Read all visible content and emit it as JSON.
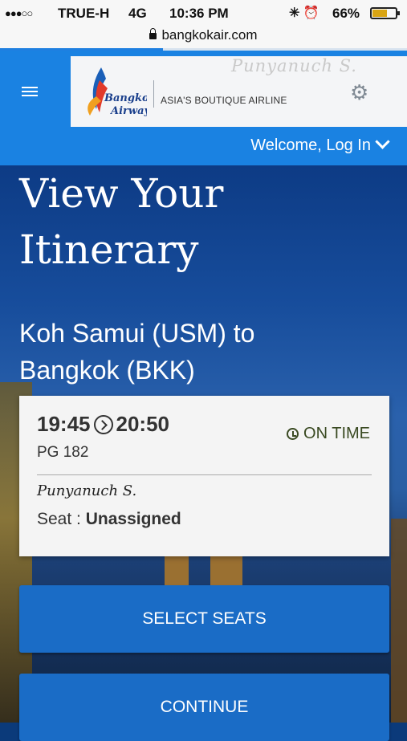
{
  "status_bar": {
    "signal": "●●●○○",
    "carrier": "TRUE-H",
    "network": "4G",
    "time": "10:36 PM",
    "battery_pct": "66%",
    "battery_level": 0.66
  },
  "browser": {
    "url": "bangkokair.com",
    "load_progress": 0.4
  },
  "header": {
    "brand_line1": "Bangkok",
    "brand_line2": "Airways",
    "tagline": "ASIA'S BOUTIQUE AIRLINE",
    "watermark": "Punyanuch S.",
    "welcome_text": "Welcome, Log In"
  },
  "page": {
    "title": "View Your Itinerary",
    "route_line1": "Koh Samui (USM) to",
    "route_line2": "Bangkok (BKK)"
  },
  "flight": {
    "departure": "19:45",
    "arrival": "20:50",
    "flight_number": "PG 182",
    "status": "ON TIME",
    "passenger_signature": "Punyanuch S.",
    "seat_label": "Seat :",
    "seat_value": "Unassigned"
  },
  "actions": {
    "select_seats": "SELECT SEATS",
    "continue": "CONTINUE"
  },
  "colors": {
    "brand_blue": "#1a82e2",
    "button_blue": "#1a6cc6",
    "status_green": "#3a4a22"
  }
}
